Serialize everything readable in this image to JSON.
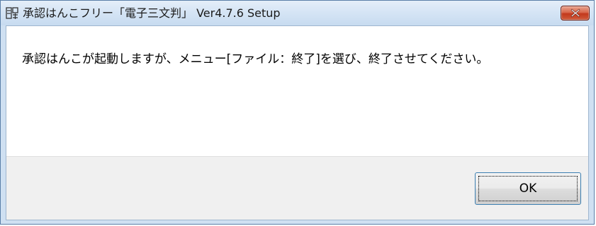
{
  "window": {
    "title": "承認はんこフリー「電子三文判」 Ver4.7.6 Setup"
  },
  "dialog": {
    "message": "承認はんこが起動しますが、メニュー[ファイル：終了]を選び、終了させてください。",
    "ok_label": "OK"
  },
  "icons": {
    "app": "stamp-app-icon",
    "close": "close-icon"
  },
  "colors": {
    "close_button": "#c2391c",
    "titlebar": "#d6e5f5",
    "footer": "#f0f0f0",
    "ok_border": "#3c7fb1"
  }
}
